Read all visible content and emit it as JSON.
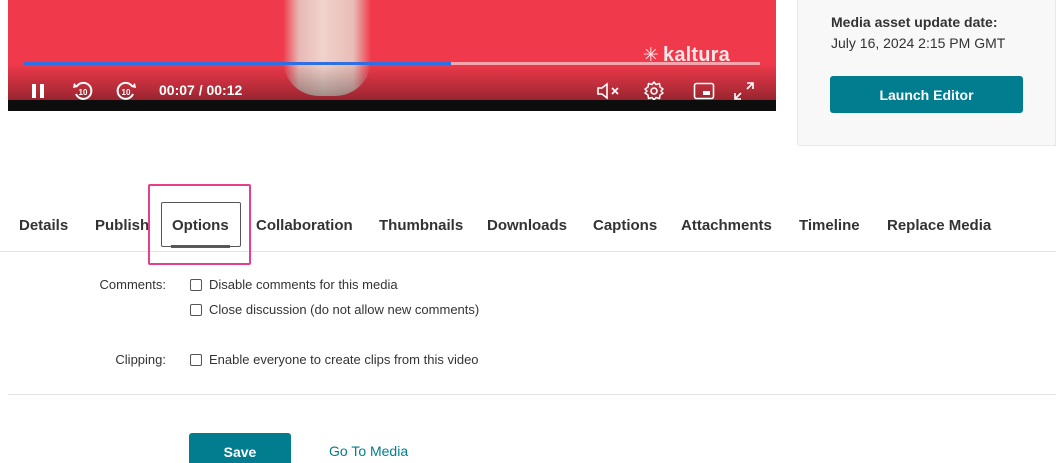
{
  "player": {
    "time_display": "00:07 / 00:12",
    "progress": 0.58,
    "brand": "kaltura",
    "icons": [
      "pause-icon",
      "rewind-10-icon",
      "forward-10-icon",
      "mute-icon",
      "settings-icon",
      "picture-in-picture-icon",
      "fullscreen-icon"
    ],
    "colors": {
      "background": "#f03a4b",
      "progress": "#2f6fe3"
    }
  },
  "side_panel": {
    "update_title": "Media asset update date:",
    "update_date": "July 16, 2024 2:15 PM GMT",
    "launch_editor": "Launch Editor"
  },
  "tabs": [
    {
      "label": "Details"
    },
    {
      "label": "Publish"
    },
    {
      "label": "Options",
      "active": true
    },
    {
      "label": "Collaboration"
    },
    {
      "label": "Thumbnails"
    },
    {
      "label": "Downloads"
    },
    {
      "label": "Captions"
    },
    {
      "label": "Attachments"
    },
    {
      "label": "Timeline"
    },
    {
      "label": "Replace Media"
    }
  ],
  "options": {
    "comments_label": "Comments:",
    "disable_comments": "Disable comments for this media",
    "close_discussion": "Close discussion (do not allow new comments)",
    "clipping_label": "Clipping:",
    "enable_clips": "Enable everyone to create clips from this video"
  },
  "actions": {
    "save": "Save",
    "go_to_media": "Go To Media"
  },
  "colors": {
    "accent": "#027d8f",
    "highlight": "#e83e8c"
  }
}
